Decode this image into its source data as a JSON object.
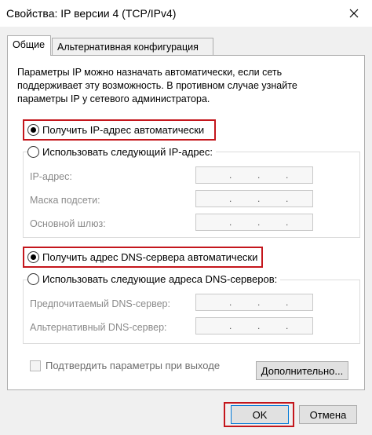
{
  "window": {
    "title": "Свойства: IP версии 4 (TCP/IPv4)"
  },
  "tabs": [
    {
      "label": "Общие",
      "active": true
    },
    {
      "label": "Альтернативная конфигурация",
      "active": false
    }
  ],
  "description": {
    "lines": [
      "Параметры IP можно назначать автоматически, если сеть",
      "поддерживает эту возможность. В противном случае узнайте",
      "параметры IP у сетевого администратора."
    ]
  },
  "ip_section": {
    "auto_label": "Получить IP-адрес автоматически",
    "auto_checked": true,
    "manual_label": "Использовать следующий IP-адрес:",
    "manual_checked": false,
    "fields": [
      {
        "label": "IP-адрес:",
        "value": ". . ."
      },
      {
        "label": "Маска подсети:",
        "value": ". . ."
      },
      {
        "label": "Основной шлюз:",
        "value": ". . ."
      }
    ]
  },
  "dns_section": {
    "auto_label": "Получить адрес DNS-сервера автоматически",
    "auto_checked": true,
    "manual_label": "Использовать следующие адреса DNS-серверов:",
    "manual_checked": false,
    "fields": [
      {
        "label": "Предпочитаемый DNS-сервер:",
        "value": ". . ."
      },
      {
        "label": "Альтернативный DNS-сервер:",
        "value": ". . ."
      }
    ]
  },
  "validate_on_exit": {
    "label": "Подтвердить параметры при выходе",
    "checked": false
  },
  "buttons": {
    "advanced": "Дополнительно...",
    "ok": "OK",
    "cancel": "Отмена"
  },
  "colors": {
    "highlight": "#c4161c",
    "dialog_background": "#f0f0f0",
    "default_button_border": "#0078d7"
  },
  "icons": {
    "close": "close-icon"
  }
}
